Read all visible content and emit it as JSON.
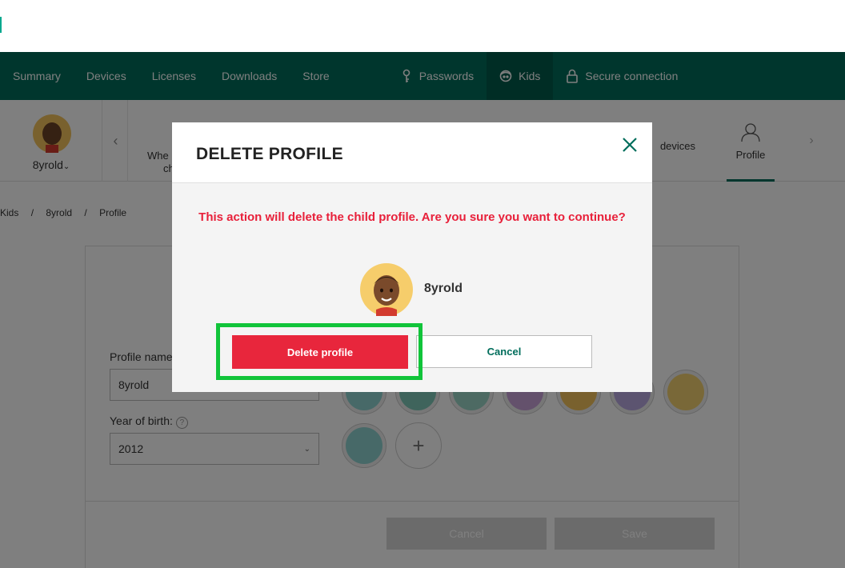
{
  "nav": {
    "items": [
      "Summary",
      "Devices",
      "Licenses",
      "Downloads",
      "Store"
    ],
    "passwords": "Passwords",
    "kids": "Kids",
    "secure": "Secure connection"
  },
  "subnav": {
    "child_name": "8yrold",
    "partial_tab_line1": "Whe",
    "partial_tab_line2": "ch",
    "devices_label": "devices",
    "profile_label": "Profile"
  },
  "breadcrumb": [
    "Kids",
    "/",
    "8yrold",
    "/",
    "Profile"
  ],
  "form": {
    "profile_name_label": "Profile name",
    "profile_name_value": "8yrold",
    "year_label": "Year of birth:",
    "year_value": "2012",
    "cancel_label": "Cancel",
    "save_label": "Save"
  },
  "modal": {
    "title": "DELETE PROFILE",
    "warning": "This action will delete the child profile. Are you sure you want to continue?",
    "child_name": "8yrold",
    "delete_label": "Delete profile",
    "cancel_label": "Cancel"
  },
  "colors": {
    "brand": "#006d5b",
    "danger": "#e8263c",
    "highlight": "#11c43a"
  }
}
